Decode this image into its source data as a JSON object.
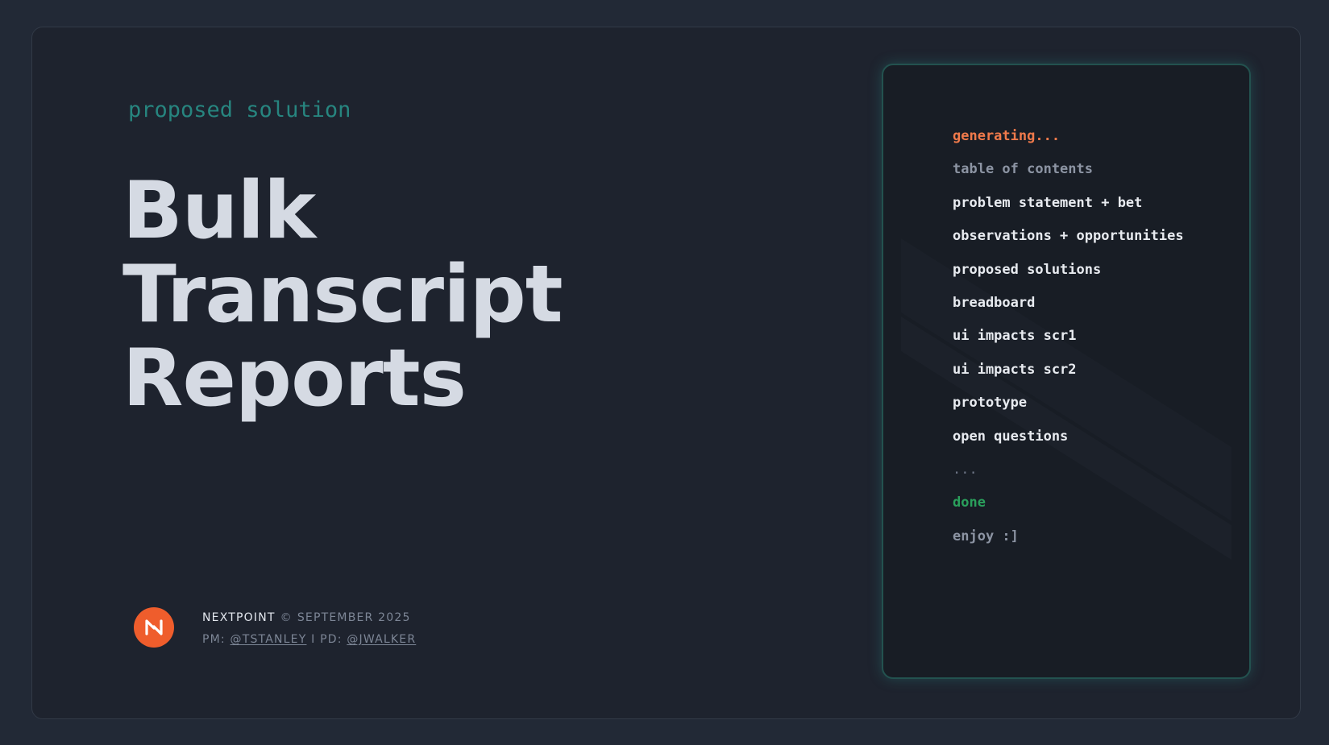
{
  "slide": {
    "eyebrow": "proposed solution",
    "title_lines": [
      "Bulk",
      "Transcript",
      "Reports"
    ]
  },
  "footer": {
    "logo_icon": "nextpoint-logo-icon",
    "brand": "NEXTPOINT",
    "copyright_symbol": "©",
    "date": "SEPTEMBER 2025",
    "pm_label": "PM:",
    "pm_handle": "@TSTANLEY",
    "separator": "I",
    "pd_label": "PD:",
    "pd_handle": "@JWALKER"
  },
  "terminal": {
    "lines": [
      {
        "text": "generating...",
        "style": "orange"
      },
      {
        "text": "table of contents",
        "style": "muted"
      },
      {
        "text": "problem statement + bet",
        "style": "white"
      },
      {
        "text": "observations + opportunities",
        "style": "white"
      },
      {
        "text": "proposed solutions",
        "style": "white"
      },
      {
        "text": "breadboard",
        "style": "white"
      },
      {
        "text": "ui impacts scr1",
        "style": "white"
      },
      {
        "text": "ui impacts scr2",
        "style": "white"
      },
      {
        "text": "prototype",
        "style": "white"
      },
      {
        "text": "open questions",
        "style": "white"
      },
      {
        "text": "...",
        "style": "dots"
      },
      {
        "text": "done",
        "style": "green"
      },
      {
        "text": "enjoy :]",
        "style": "muted"
      }
    ]
  },
  "colors": {
    "page_bg": "#222936",
    "slide_bg": "#1e232e",
    "accent_teal": "#27857f",
    "logo_orange": "#ef5d2c",
    "status_orange": "#f07a4b",
    "status_green": "#2aa05c",
    "title_text": "#d5dae3"
  }
}
